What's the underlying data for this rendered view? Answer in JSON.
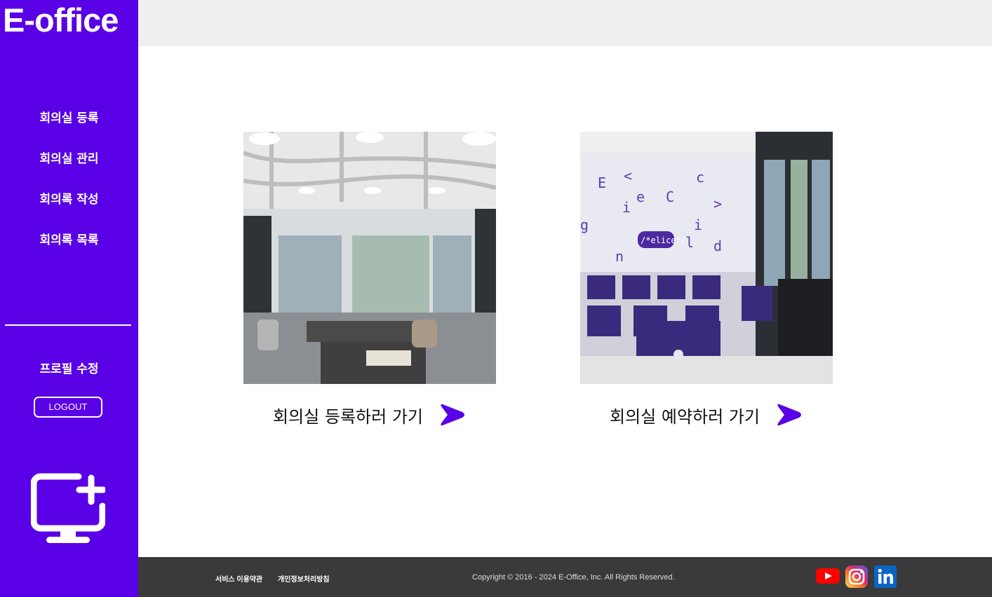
{
  "brand": {
    "logo_text": "E-office",
    "accent": "#5a00e6"
  },
  "sidebar": {
    "items": [
      {
        "label": "회의실 등록"
      },
      {
        "label": "회의실 관리"
      },
      {
        "label": "회의록 작성"
      },
      {
        "label": "회의록 목록"
      }
    ],
    "profile_label": "프로필 수정",
    "logout_label": "LOGOUT",
    "bottom_icon": "monitor-plus-icon"
  },
  "main": {
    "cards": [
      {
        "label": "회의실 등록하러 가기",
        "image": "lounge-photo",
        "arrow_icon": "arrow-right-icon"
      },
      {
        "label": "회의실 예약하러 가기",
        "image": "classroom-photo",
        "arrow_icon": "arrow-right-icon"
      }
    ]
  },
  "footer": {
    "terms_label": "서비스 이용약관",
    "privacy_label": "개인정보처리방침",
    "copyright": "Copyright © 2016 - 2024 E-Office, Inc. All Rights Reserved.",
    "social_icons": [
      "youtube-icon",
      "instagram-icon",
      "linkedin-icon"
    ]
  }
}
